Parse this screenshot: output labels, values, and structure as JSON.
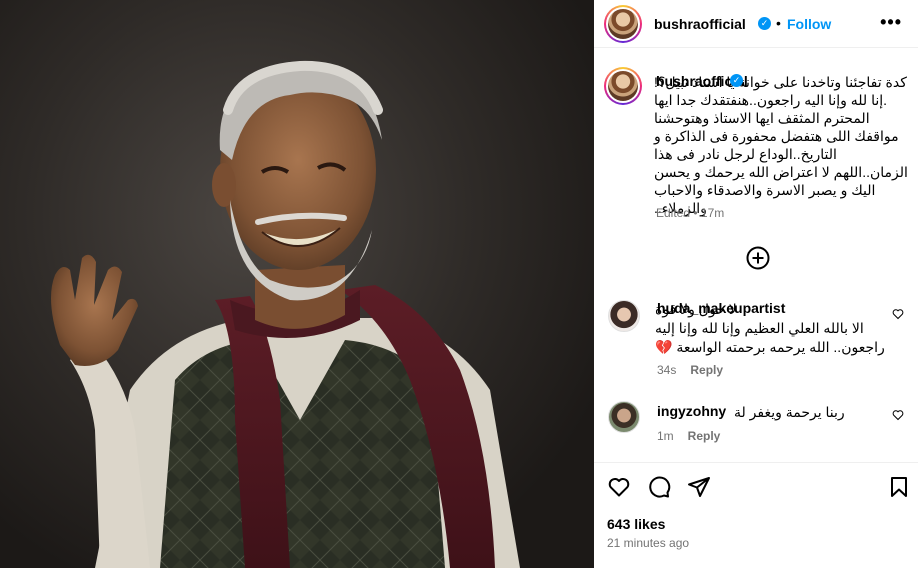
{
  "post": {
    "username": "bushraofficial",
    "follow_label": "Follow",
    "more_label": "•••",
    "verified_glyph": "✓",
    "separator": "•"
  },
  "caption": {
    "username": "bushraofficial",
    "text": "كدة تفاجئنا وتاخدنا على خوانة يا استاذ نبيل؟! .إنا لله وإنا اليه راجعون..هنفتقدك جدا ايها المحترم المثقف ايها الاستاذ وهتوحشنا مواقفك اللى هتفضل محفورة فى الذاكرة و التاريخ..الوداع لرجل نادر فى هذا الزمان..اللهم لا اعتراض الله يرحمك و يحسن اليك و يصبر الاسرة والاصدقاء والاحباب والزملاء..",
    "edited": "Edited",
    "time": "17m"
  },
  "comments": [
    {
      "username": "huda_makeupartist",
      "text": "لا حول ولا قوة الا بالله العلي العظيم وإنا لله وإنا إليه راجعون.. الله يرحمه برحمته الواسعة 💔",
      "time": "34s",
      "reply": "Reply"
    },
    {
      "username": "ingyzohny",
      "text": "ربنا يرحمة ويغفر لة",
      "time": "1m",
      "reply": "Reply"
    }
  ],
  "icons": {
    "like": "heart-icon",
    "comment": "comment-icon",
    "share": "share-icon",
    "save": "bookmark-icon",
    "load_more": "plus-circle-icon"
  },
  "stats": {
    "likes": "643 likes",
    "time_ago": "21 minutes ago"
  },
  "colors": {
    "accent": "#0095f6",
    "muted": "#737373"
  }
}
